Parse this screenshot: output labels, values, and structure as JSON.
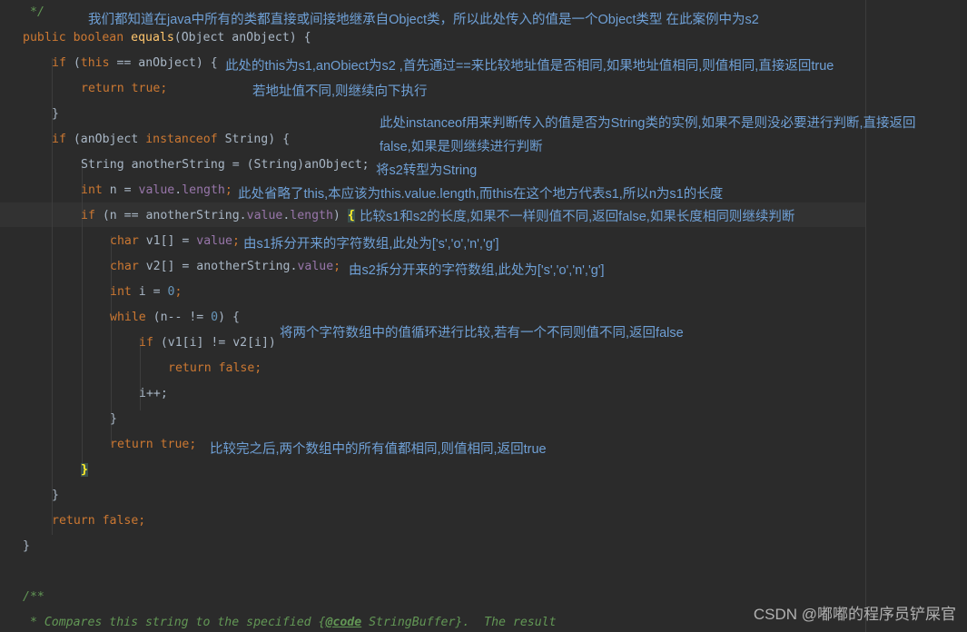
{
  "code": {
    "l0_comment_end": "*/",
    "l1": {
      "kw1": "public",
      "kw2": "boolean",
      "method": "equals",
      "rest": "(Object anObject) {"
    },
    "l2": {
      "kw": "if",
      "rest1": " (",
      "this": "this",
      "rest2": " == anObject) {"
    },
    "l3": {
      "kw": "return",
      "val": "true",
      "semi": ";"
    },
    "l4": "}",
    "l5": {
      "kw": "if",
      "rest1": " (anObject ",
      "kw2": "instanceof",
      "rest2": " String) {"
    },
    "l6": {
      "text": "String anotherString = (String)anObject;"
    },
    "l7": {
      "kw": "int",
      "rest1": " n = ",
      "fld1": "value",
      "dot": ".",
      "fld2": "length",
      "semi": ";"
    },
    "l8": {
      "kw": "if",
      "rest1": " (n == anotherString.",
      "fld1": "value",
      "dot": ".",
      "fld2": "length",
      "rest2": ") ",
      "brace": "{"
    },
    "l9": {
      "kw": "char",
      "rest1": " v1[] = ",
      "fld": "value",
      "semi": ";"
    },
    "l10": {
      "kw": "char",
      "rest1": " v2[] = anotherString.",
      "fld": "value",
      "semi": ";"
    },
    "l11": {
      "kw": "int",
      "rest1": " i = ",
      "num": "0",
      "semi": ";"
    },
    "l12": {
      "kw": "while",
      "rest1": " (n-- != ",
      "num": "0",
      "rest2": ") {"
    },
    "l13": {
      "kw": "if",
      "rest1": " (v1[i] != v2[i])"
    },
    "l14": {
      "kw": "return",
      "val": "false",
      "semi": ";"
    },
    "l15": "i++;",
    "l16": "}",
    "l17": {
      "kw": "return",
      "val": "true",
      "semi": ";"
    },
    "l18": "}",
    "l19": "}",
    "l20": {
      "kw": "return",
      "val": "false",
      "semi": ";"
    },
    "l21": "}",
    "l22": "/**",
    "l23": {
      "pre": " * Compares this string to the specified {",
      "tag": "@code",
      "post": " StringBuffer}.  The result"
    }
  },
  "notes": {
    "n1": "我们都知道在java中所有的类都直接或间接地继承自Object类，所以此处传入的值是一个Object类型 在此案例中为s2",
    "n2": "此处的this为s1,anObiect为s2 ,首先通过==来比较地址值是否相同,如果地址值相同,则值相同,直接返回true",
    "n3": "若地址值不同,则继续向下执行",
    "n4a": "此处instanceof用来判断传入的值是否为String类的实例,如果不是则没必要进行判断,直接返回",
    "n4b": "false,如果是则继续进行判断",
    "n5": "将s2转型为String",
    "n6": "此处省略了this,本应该为this.value.length,而this在这个地方代表s1,所以n为s1的长度",
    "n7": "比较s1和s2的长度,如果不一样则值不同,返回false,如果长度相同则继续判断",
    "n8": "由s1拆分开来的字符数组,此处为['s','o','n','g']",
    "n9": "由s2拆分开来的字符数组,此处为['s','o','n','g']",
    "n10": "将两个字符数组中的值循环进行比较,若有一个不同则值不同,返回false",
    "n11": "比较完之后,两个数组中的所有值都相同,则值相同,返回true"
  },
  "watermark": "CSDN @嘟嘟的程序员铲屎官",
  "colors": {
    "background": "#2b2b2b",
    "keyword": "#cc7832",
    "method": "#ffc66d",
    "field": "#9876aa",
    "number": "#6897bb",
    "comment": "#629755",
    "annotation": "#6fa0d6"
  }
}
